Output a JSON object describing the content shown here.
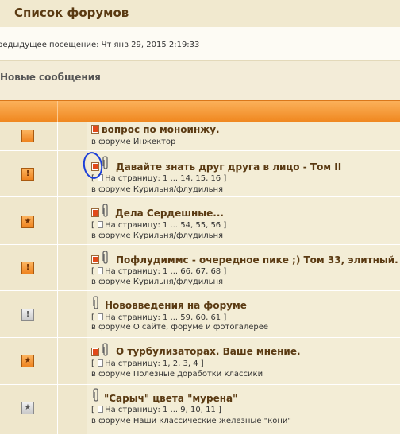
{
  "header": {
    "title": "Список форумов"
  },
  "last_visit": "редыдущее посещение: Чт янв 29, 2015 2:19:33",
  "section_title": "Новые сообщения",
  "colors": {
    "accent": "#f08820",
    "title_text": "#5a3a12",
    "annotation": "#1c3fd8"
  },
  "topics": [
    {
      "title": "вопрос по моноинжу.",
      "pages": "",
      "forum": "в форуме Инжектор",
      "status_icon": "topic-read-icon",
      "has_attachment": false,
      "unread_icon": true
    },
    {
      "title": "Давайте знать друг друга в лицо - Том II",
      "pages": "На страницу: 1 ... 14, 15, 16 ]",
      "forum": "в форуме Курильня/флудильня",
      "status_icon": "topic-hot-icon",
      "has_attachment": true,
      "unread_icon": true
    },
    {
      "title": "Дела Сердешные...",
      "pages": "На страницу: 1 ... 54, 55, 56 ]",
      "forum": "в форуме Курильня/флудильня",
      "status_icon": "topic-sticky-icon",
      "has_attachment": true,
      "unread_icon": true
    },
    {
      "title": "Пофлудиммс - очередное пике ;) Том 33, элитный.",
      "pages": "На страницу: 1 ... 66, 67, 68 ]",
      "forum": "в форуме Курильня/флудильня",
      "status_icon": "topic-hot-icon",
      "has_attachment": true,
      "unread_icon": true
    },
    {
      "title": "Нововведения на форуме",
      "pages": "На страницу: 1 ... 59, 60, 61 ]",
      "forum": "в форуме О сайте, форуме и фотогалерее",
      "status_icon": "topic-hot-read-icon",
      "has_attachment": true,
      "unread_icon": false
    },
    {
      "title": "О турбулизаторах. Ваше мнение.",
      "pages": "На страницу: 1, 2, 3, 4 ]",
      "forum": "в форуме Полезные доработки классики",
      "status_icon": "topic-sticky-icon",
      "has_attachment": true,
      "unread_icon": true
    },
    {
      "title": "\"Сарыч\" цвета \"мурена\"",
      "pages": "На страницу: 1 ... 9, 10, 11 ]",
      "forum": "в форуме Наши классические железные \"кони\"",
      "status_icon": "topic-sticky-read-icon",
      "has_attachment": true,
      "unread_icon": false
    }
  ]
}
